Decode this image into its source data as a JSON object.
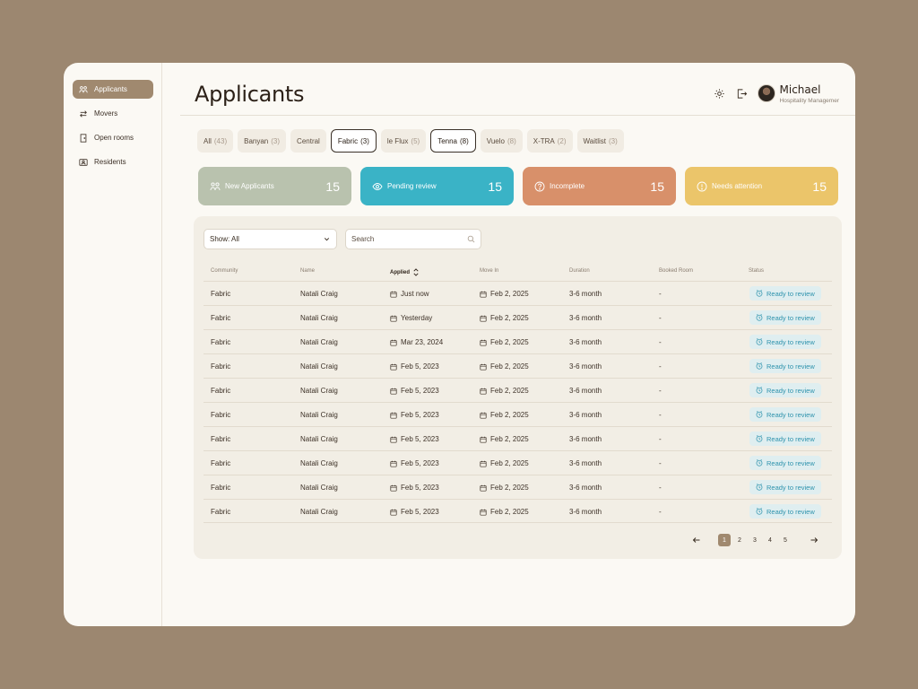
{
  "sidebar": {
    "items": [
      {
        "label": "Applicants",
        "icon": "users-icon",
        "active": true
      },
      {
        "label": "Movers",
        "icon": "swap-arrows-icon",
        "active": false
      },
      {
        "label": "Open rooms",
        "icon": "door-icon",
        "active": false
      },
      {
        "label": "Residents",
        "icon": "id-card-icon",
        "active": false
      }
    ]
  },
  "header": {
    "title": "Applicants",
    "user_name": "Michael",
    "user_role": "Hospitality Managemer"
  },
  "filters": [
    {
      "label": "All",
      "count": "(43)",
      "selected": false
    },
    {
      "label": "Banyan",
      "count": "(3)",
      "selected": false
    },
    {
      "label": "Central",
      "count": "",
      "selected": false
    },
    {
      "label": "Fabric",
      "count": "(3)",
      "selected": true
    },
    {
      "label": "le Flux",
      "count": "(5)",
      "selected": false
    },
    {
      "label": "Tenna",
      "count": "(8)",
      "selected": true
    },
    {
      "label": "Vuelo",
      "count": "(8)",
      "selected": false
    },
    {
      "label": "X-TRA",
      "count": "(2)",
      "selected": false
    },
    {
      "label": "Waitlist",
      "count": "(3)",
      "selected": false
    }
  ],
  "stats": [
    {
      "label": "New Applicants",
      "value": "15",
      "icon": "users-icon",
      "color": "#b9c2ae"
    },
    {
      "label": "Pending review",
      "value": "15",
      "icon": "eye-icon",
      "color": "#3ab3c6"
    },
    {
      "label": "Incomplete",
      "value": "15",
      "icon": "question-circle-icon",
      "color": "#d8906a"
    },
    {
      "label": "Needs attention",
      "value": "15",
      "icon": "alert-circle-icon",
      "color": "#ebc56a"
    }
  ],
  "table": {
    "show_select": "Show: All",
    "search_placeholder": "Search",
    "columns": [
      "Community",
      "Name",
      "Applied",
      "Move In",
      "Duration",
      "Booked Room",
      "Status"
    ],
    "rows": [
      {
        "community": "Fabric",
        "name": "Natali Craig",
        "applied": "Just now",
        "move_in": "Feb 2, 2025",
        "duration": "3-6 month",
        "booked": "-",
        "status": "Ready to review"
      },
      {
        "community": "Fabric",
        "name": "Natali Craig",
        "applied": "Yesterday",
        "move_in": "Feb 2, 2025",
        "duration": "3-6 month",
        "booked": "-",
        "status": "Ready to review"
      },
      {
        "community": "Fabric",
        "name": "Natali Craig",
        "applied": "Mar 23, 2024",
        "move_in": "Feb 2, 2025",
        "duration": "3-6 month",
        "booked": "-",
        "status": "Ready to review"
      },
      {
        "community": "Fabric",
        "name": "Natali Craig",
        "applied": "Feb 5, 2023",
        "move_in": "Feb 2, 2025",
        "duration": "3-6 month",
        "booked": "-",
        "status": "Ready to review"
      },
      {
        "community": "Fabric",
        "name": "Natali Craig",
        "applied": "Feb 5, 2023",
        "move_in": "Feb 2, 2025",
        "duration": "3-6 month",
        "booked": "-",
        "status": "Ready to review"
      },
      {
        "community": "Fabric",
        "name": "Natali Craig",
        "applied": "Feb 5, 2023",
        "move_in": "Feb 2, 2025",
        "duration": "3-6 month",
        "booked": "-",
        "status": "Ready to review"
      },
      {
        "community": "Fabric",
        "name": "Natali Craig",
        "applied": "Feb 5, 2023",
        "move_in": "Feb 2, 2025",
        "duration": "3-6 month",
        "booked": "-",
        "status": "Ready to review"
      },
      {
        "community": "Fabric",
        "name": "Natali Craig",
        "applied": "Feb 5, 2023",
        "move_in": "Feb 2, 2025",
        "duration": "3-6 month",
        "booked": "-",
        "status": "Ready to review"
      },
      {
        "community": "Fabric",
        "name": "Natali Craig",
        "applied": "Feb 5, 2023",
        "move_in": "Feb 2, 2025",
        "duration": "3-6 month",
        "booked": "-",
        "status": "Ready to review"
      },
      {
        "community": "Fabric",
        "name": "Natali Craig",
        "applied": "Feb 5, 2023",
        "move_in": "Feb 2, 2025",
        "duration": "3-6 month",
        "booked": "-",
        "status": "Ready to review"
      }
    ]
  },
  "pagination": {
    "pages": [
      "1",
      "2",
      "3",
      "4",
      "5"
    ],
    "current": "1"
  },
  "colors": {
    "accent": "#a0896f",
    "status_text": "#2f93ad",
    "status_bg": "#dfeef0"
  }
}
